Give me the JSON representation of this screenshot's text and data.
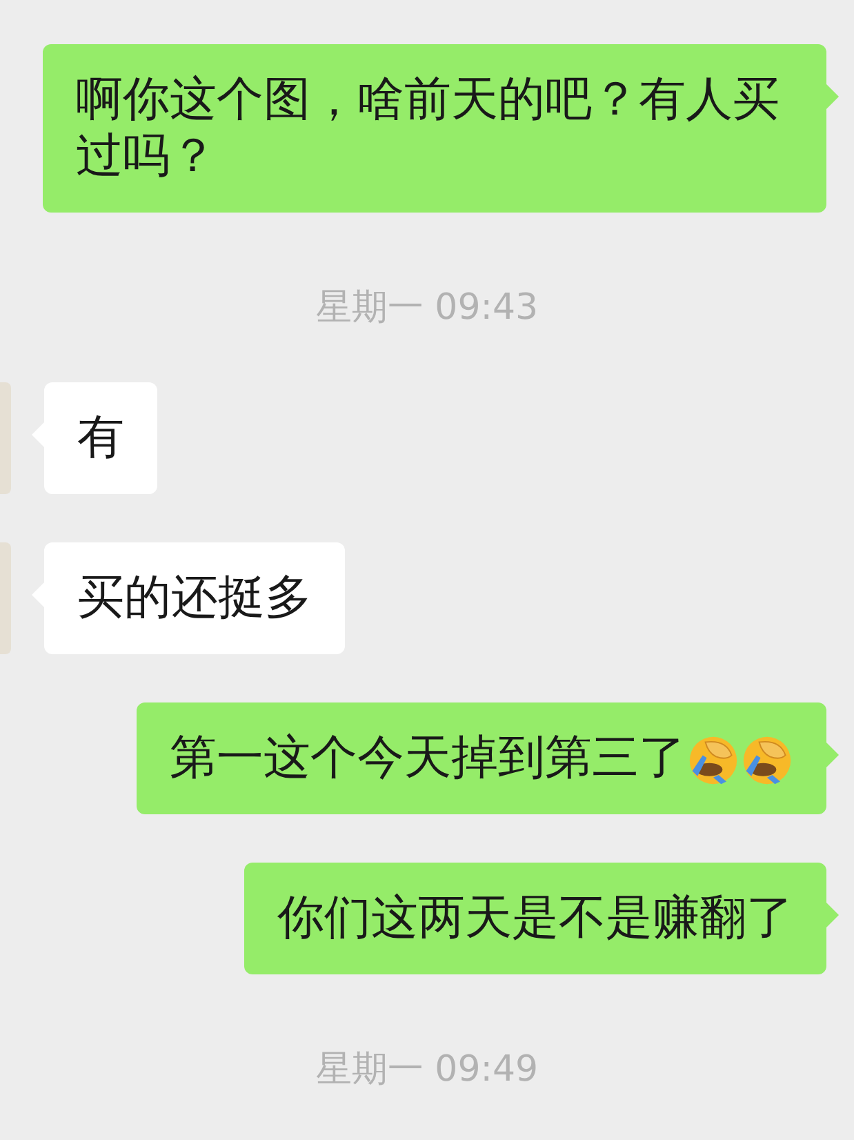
{
  "messages": [
    {
      "kind": "sent",
      "text": "啊你这个图，啥前天的吧？有人买过吗？"
    },
    {
      "kind": "time",
      "text": "星期一 09:43"
    },
    {
      "kind": "received",
      "text": "有"
    },
    {
      "kind": "received",
      "text": "买的还挺多"
    },
    {
      "kind": "sent",
      "text": "第一这个今天掉到第三了",
      "emojis": [
        {
          "kind": "facepalm"
        },
        {
          "kind": "facepalm"
        }
      ]
    },
    {
      "kind": "sent",
      "text": "你们这两天是不是赚翻了"
    },
    {
      "kind": "time",
      "text": "星期一 09:49"
    }
  ]
}
